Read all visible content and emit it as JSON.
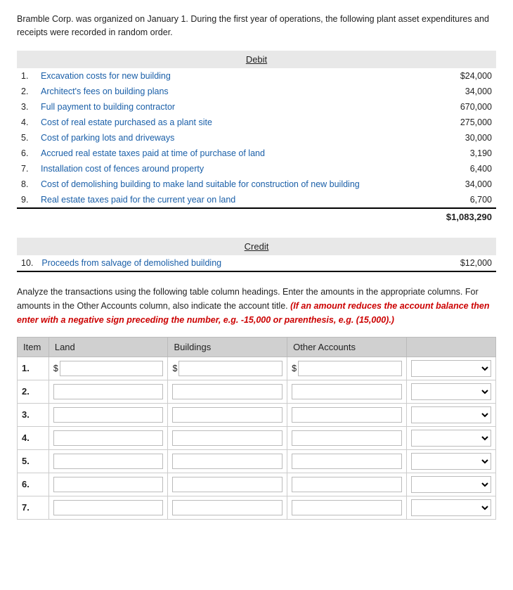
{
  "intro": {
    "text": "Bramble Corp. was organized on January 1. During the first year of operations, the following plant asset expenditures and receipts were recorded in random order."
  },
  "debit_section": {
    "header": "Debit",
    "items": [
      {
        "num": "1.",
        "desc": "Excavation costs for new building",
        "amount": "$24,000"
      },
      {
        "num": "2.",
        "desc": "Architect's fees on building plans",
        "amount": "34,000"
      },
      {
        "num": "3.",
        "desc": "Full payment to building contractor",
        "amount": "670,000"
      },
      {
        "num": "4.",
        "desc": "Cost of real estate purchased as a plant site",
        "amount": "275,000"
      },
      {
        "num": "5.",
        "desc": "Cost of parking lots and driveways",
        "amount": "30,000"
      },
      {
        "num": "6.",
        "desc": "Accrued real estate taxes paid at time of purchase of land",
        "amount": "3,190"
      },
      {
        "num": "7.",
        "desc": "Installation cost of fences around property",
        "amount": "6,400"
      },
      {
        "num": "8.",
        "desc": "Cost of demolishing building to make land suitable for construction of new building",
        "amount": "34,000"
      },
      {
        "num": "9.",
        "desc": "Real estate taxes paid for the current year on land",
        "amount": "6,700"
      }
    ],
    "total": "$1,083,290"
  },
  "credit_section": {
    "header": "Credit",
    "items": [
      {
        "num": "10.",
        "desc": "Proceeds from salvage of demolished building",
        "amount": "$12,000"
      }
    ]
  },
  "analysis": {
    "text_normal": "Analyze the transactions using the following table column headings. Enter the amounts in the appropriate columns. For amounts in the Other Accounts column, also indicate the account title. ",
    "text_italic_red": "(If an amount reduces the account balance then enter with a negative sign preceding the number, e.g. -15,000 or parenthesis, e.g. (15,000).)"
  },
  "input_table": {
    "headers": [
      "Item",
      "Land",
      "Buildings",
      "Other Accounts"
    ],
    "rows": [
      {
        "num": "1.",
        "has_dollar": true
      },
      {
        "num": "2.",
        "has_dollar": false
      },
      {
        "num": "3.",
        "has_dollar": false
      },
      {
        "num": "4.",
        "has_dollar": false
      },
      {
        "num": "5.",
        "has_dollar": false
      },
      {
        "num": "6.",
        "has_dollar": false
      },
      {
        "num": "7.",
        "has_dollar": false
      }
    ]
  }
}
